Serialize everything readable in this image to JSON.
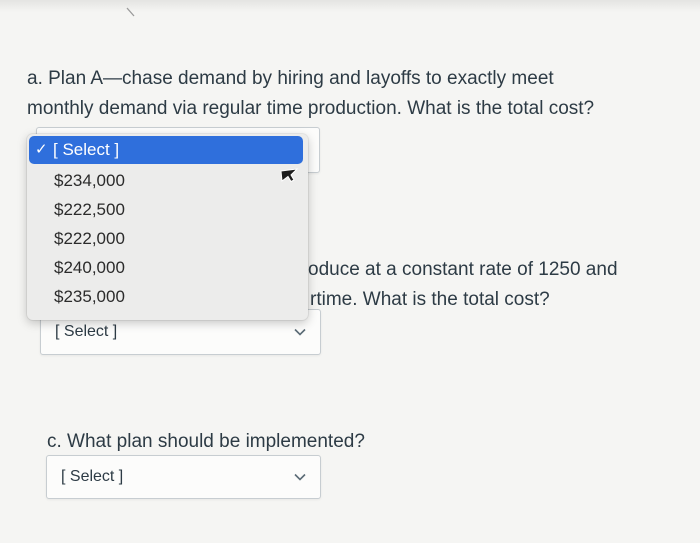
{
  "question_a": {
    "line1": "a. Plan A—chase demand by hiring and layoffs to exactly meet",
    "line2": "monthly demand via regular time production. What is the total cost?",
    "dropdown": {
      "selected_label": "[ Select ]",
      "options": [
        "$234,000",
        "$222,500",
        "$222,000",
        "$240,000",
        "$235,000"
      ]
    }
  },
  "question_b": {
    "line1_partial": "oduce at a constant rate of 1250 and",
    "line2_partial": "rtime. What is the total cost?",
    "select_value": "[ Select ]"
  },
  "question_c": {
    "text": "c. What plan should be implemented?",
    "select_value": "[ Select ]"
  },
  "icons": {
    "check": "checkmark-icon",
    "chevron": "chevron-down-icon",
    "cursor": "mouse-pointer-icon"
  },
  "colors": {
    "highlight": "#2f6fdc",
    "text": "#2d3b45",
    "chevron": "#5b6b76"
  }
}
